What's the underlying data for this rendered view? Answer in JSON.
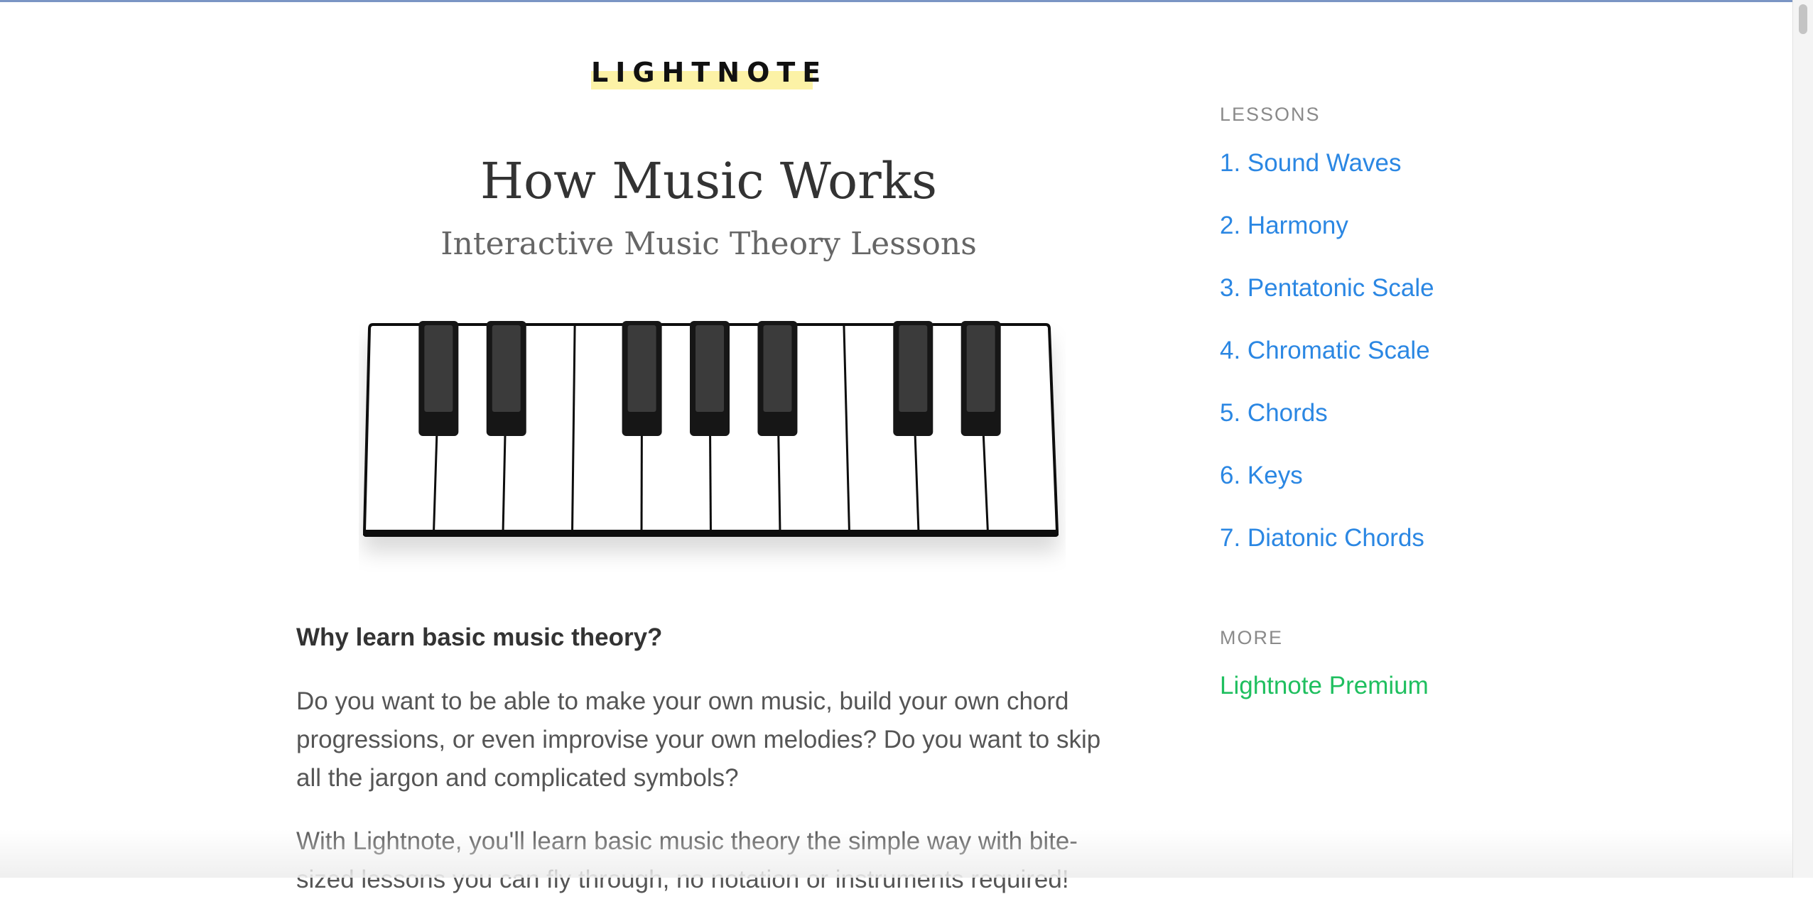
{
  "logo": {
    "text": "LIGHTNOTE"
  },
  "hero": {
    "title": "How Music Works",
    "subtitle": "Interactive Music Theory Lessons"
  },
  "piano": {
    "white_key_count": 10,
    "black_key_count": 7
  },
  "intro": {
    "heading": "Why learn basic music theory?",
    "paragraph1": "Do you want to be able to make your own music, build your own chord progressions, or even improvise your own melodies? Do you want to skip all the jargon and complicated symbols?",
    "paragraph2": "With Lightnote, you'll learn basic music theory the simple way with bite-sized lessons you can fly through, no notation or instruments required!"
  },
  "sidebar": {
    "lessons_label": "LESSONS",
    "lessons": [
      {
        "label": "1. Sound Waves"
      },
      {
        "label": "2. Harmony"
      },
      {
        "label": "3. Pentatonic Scale"
      },
      {
        "label": "4. Chromatic Scale"
      },
      {
        "label": "5. Chords"
      },
      {
        "label": "6. Keys"
      },
      {
        "label": "7. Diatonic Chords"
      }
    ],
    "more_label": "MORE",
    "premium_link": "Lightnote Premium"
  },
  "colors": {
    "link": "#2b87e3",
    "premium": "#1fbf5f",
    "logo_highlight": "#fcf2a6",
    "text": "#333333"
  }
}
